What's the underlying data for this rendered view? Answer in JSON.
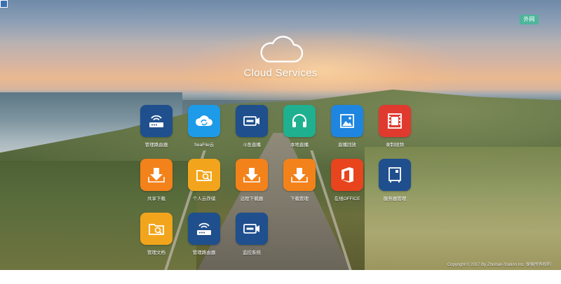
{
  "header": {
    "title": "Cloud Services",
    "external_button": "外网"
  },
  "apps": [
    {
      "label": "管理路由器",
      "icon": "router-icon",
      "color": "#1f4f8d"
    },
    {
      "label": "SeaFile云",
      "icon": "cloud-sync-icon",
      "color": "#1e9be8"
    },
    {
      "label": "斗鱼直播",
      "icon": "video-camera-icon",
      "color": "#1f4f8d"
    },
    {
      "label": "本地直播",
      "icon": "headphones-icon",
      "color": "#1fb08f"
    },
    {
      "label": "直播回放",
      "icon": "image-icon",
      "color": "#1e86e0"
    },
    {
      "label": "录制视频",
      "icon": "film-icon",
      "color": "#e03a2f"
    },
    {
      "label": "共享下载",
      "icon": "download-icon",
      "color": "#f3821a"
    },
    {
      "label": "个人云存储",
      "icon": "folder-search-icon",
      "color": "#f2a51c"
    },
    {
      "label": "远程下载器",
      "icon": "download-icon",
      "color": "#f3821a"
    },
    {
      "label": "下载管理",
      "icon": "download-icon",
      "color": "#f3821a"
    },
    {
      "label": "在线OFFICE",
      "icon": "office-icon",
      "color": "#e8441e"
    },
    {
      "label": "服务器管理",
      "icon": "server-icon",
      "color": "#1f4f8d"
    },
    {
      "label": "管理文档",
      "icon": "folder-search-icon",
      "color": "#f2a51c"
    },
    {
      "label": "管理路由器",
      "icon": "router-icon",
      "color": "#1f4f8d"
    },
    {
      "label": "监控系统",
      "icon": "video-camera-icon",
      "color": "#1f4f8d"
    }
  ],
  "footer": {
    "copyright": "Copyright © 2017 By Zhishan-Station Inc. 保留所有权利"
  }
}
